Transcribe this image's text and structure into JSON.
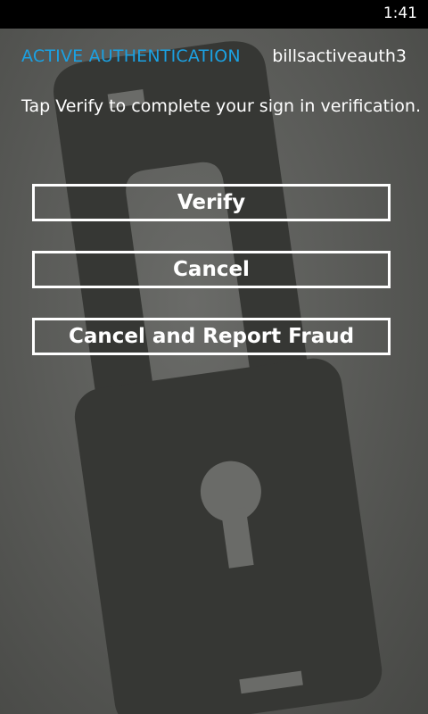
{
  "status_bar": {
    "time": "1:41"
  },
  "header": {
    "title": "ACTIVE AUTHENTICATION",
    "account": "billsactiveauth3"
  },
  "instruction": "Tap Verify to complete your sign in verification.",
  "actions": {
    "verify_label": "Verify",
    "cancel_label": "Cancel",
    "report_label": "Cancel and Report Fraud"
  },
  "colors": {
    "accent": "#1ba1e2",
    "background": "#5b5c59",
    "lock_fill": "#363734"
  },
  "background_icon": "padlock-icon"
}
